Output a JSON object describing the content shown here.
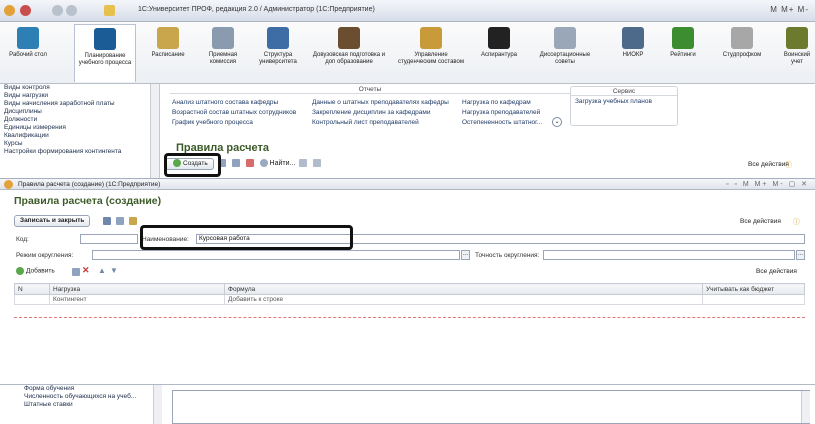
{
  "window": {
    "title": "1С:Университет ПРОФ, редакция 2.0 / Администратор (1С:Предприятие)",
    "right_controls": "M  M+  M-"
  },
  "sections": [
    {
      "label": "Рабочий стол",
      "color": "#2e7fb3"
    },
    {
      "label": "Планирование учебного процесса",
      "color": "#1c5c96",
      "active": true
    },
    {
      "label": "Расписание",
      "color": "#c9a64b"
    },
    {
      "label": "Приемная комиссия",
      "color": "#8a9bb0"
    },
    {
      "label": "Структура университета",
      "color": "#3d6da4"
    },
    {
      "label": "Довузовская подготовка и доп образование",
      "color": "#6b4d2f"
    },
    {
      "label": "Управление студенческим составом",
      "color": "#c99a3a"
    },
    {
      "label": "Аспирантура",
      "color": "#222222"
    },
    {
      "label": "Диссертационные советы",
      "color": "#9aa7b8"
    },
    {
      "label": "НИОКР",
      "color": "#4d6a8a"
    },
    {
      "label": "Рейтинги",
      "color": "#3b8d2f"
    },
    {
      "label": "Студпрофком",
      "color": "#a7a7a7"
    },
    {
      "label": "Воинский учет",
      "color": "#6b7a2d"
    }
  ],
  "leftnav": [
    "Виды контроля",
    "Виды нагрузки",
    "Виды начисления заработной платы",
    "Дисциплины",
    "Должности",
    "Единицы измерения",
    "Квалификации",
    "Курсы",
    "Настройки формирования контингента"
  ],
  "reports": {
    "header": "Отчеты",
    "col1": [
      "Анализ штатного состава кафедры",
      "Возрастной состав штатных сотрудников",
      "График учебного процесса"
    ],
    "col2": [
      "Данные о штатных преподавателях кафедры",
      "Закрепление дисциплин за кафедрами",
      "Контрольный лист преподавателей"
    ],
    "col3": [
      "Нагрузка по кафедрам",
      "Нагрузка преподавателей",
      "Остепененность штатног..."
    ]
  },
  "service": {
    "header": "Сервис",
    "item": "Загрузка учебных планов"
  },
  "bg_doc": {
    "title": "Правила расчета",
    "create_label": "Создать",
    "find_label": "Найти...",
    "all_actions": "Все действия"
  },
  "dialog": {
    "window_title": "Правила расчета (создание) (1С:Предприятие)",
    "form_title": "Правила расчета (создание)",
    "save_close": "Записать и закрыть",
    "all_actions": "Все действия",
    "code_label": "Код:",
    "code_value": "",
    "name_label": "Наименование:",
    "name_value": "Курсовая работа",
    "rounding_label": "Режим округления:",
    "precision_label": "Точность округления:",
    "add_label": "Добавить",
    "columns": [
      "N",
      "Нагрузка",
      "Формула",
      "Учитывать как бюджет"
    ],
    "row": [
      "",
      "Контингент",
      "Добавить к строке",
      ""
    ]
  },
  "bottomnav": [
    "Форма обучения",
    "Численность обучающихся на учеб...",
    "Штатные ставки"
  ]
}
